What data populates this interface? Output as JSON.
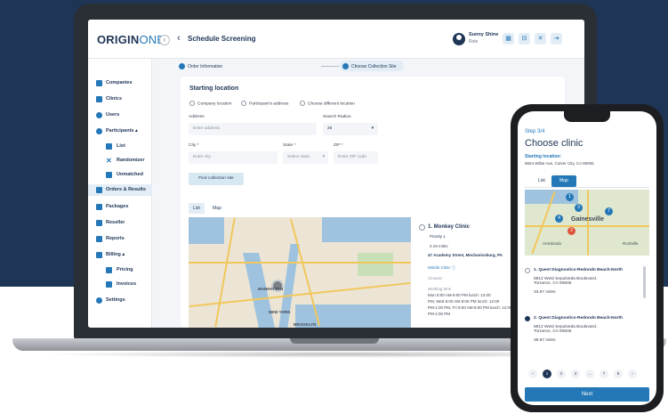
{
  "brand": {
    "logo_main": "ORIGIN",
    "logo_accent": "ONE",
    "navy": "#1e3556",
    "accent": "#2478b8"
  },
  "header": {
    "collapse_icon": "‹",
    "back_icon": "‹",
    "title": "Schedule Screening",
    "user_name": "Sunny Shine",
    "user_role": "Role",
    "icons": [
      "calendar-icon",
      "cart-icon",
      "tools-icon",
      "logout-icon"
    ]
  },
  "sidebar": {
    "items": [
      {
        "label": "Companies"
      },
      {
        "label": "Clinics"
      },
      {
        "label": "Users"
      },
      {
        "label": "Participants ▴"
      },
      {
        "label": "List"
      },
      {
        "label": "Randomizer"
      },
      {
        "label": "Unmatched"
      },
      {
        "label": "Orders & Results"
      },
      {
        "label": "Packages"
      },
      {
        "label": "Reseller"
      },
      {
        "label": "Reports"
      },
      {
        "label": "Billing ▴"
      },
      {
        "label": "Pricing"
      },
      {
        "label": "Invoices"
      },
      {
        "label": "Settings"
      }
    ]
  },
  "steps": {
    "step1": "Order Information",
    "step2": "Choose Collection Site"
  },
  "form": {
    "section_title": "Starting location",
    "radios": [
      "Company location",
      "Participant's address",
      "Choose different location"
    ],
    "address_label": "Address",
    "address_placeholder": "Enter address",
    "radius_label": "Search Radius",
    "radius_value": "25",
    "city_label": "City *",
    "city_placeholder": "Enter city",
    "state_label": "State *",
    "state_placeholder": "Select state",
    "zip_label": "ZIP *",
    "zip_placeholder": "Enter ZIP code",
    "find_button": "Find collection site"
  },
  "view_tabs": [
    "List",
    "Map"
  ],
  "map_labels": [
    "MANHATTAN",
    "NEW YORK",
    "BROOKLYN"
  ],
  "result": {
    "name": "1. Monkey Clinic",
    "priority": "Priority 1",
    "distance": "0.19 miles",
    "address": "47 Academy Street, Mechanicsburg, PA",
    "mobile": "Mobile Clinic ⓘ",
    "closure": "Closure:",
    "hours_label": "Working time",
    "hours_1": "Mon 8:00 AM-8:00 PM lunch: 12:00",
    "hours_2": "PM, Wed 8:00 AM-8:00 PM lunch: 12:00",
    "hours_3": "PM-1:00 PM, Fri 8:00 AM-8:00 PM lunch: 12:00",
    "hours_4": "PM-1:00 PM"
  },
  "phone": {
    "step": "Step 3/4",
    "title": "Choose clinic",
    "starting_label": "Starting location:",
    "starting_address": "9824 Willar Ave, Culver City, CA 90005",
    "tabs": [
      "List",
      "Map"
    ],
    "map_labels": [
      "Gainesville",
      "Arredondo",
      "Rochelle"
    ],
    "pins": [
      "1",
      "3",
      "4",
      "7",
      "2"
    ],
    "items": [
      {
        "title": "1. Quest Diagnostics-Redondo Beach-North",
        "addr1": "5812 West Sepulveda Boulevard,",
        "addr2": "Torrance, CA 90505",
        "dist": "33.97 miles"
      },
      {
        "title": "2. Quest Diagnostics-Redondo Beach-North",
        "addr1": "5812 West Sepulveda Boulevard,",
        "addr2": "Torrance, CA 90505",
        "dist": "39.97 miles"
      }
    ],
    "pager": [
      "‹",
      "1",
      "2",
      "3",
      "…",
      "7",
      "8",
      "›"
    ],
    "next_button": "Next"
  }
}
